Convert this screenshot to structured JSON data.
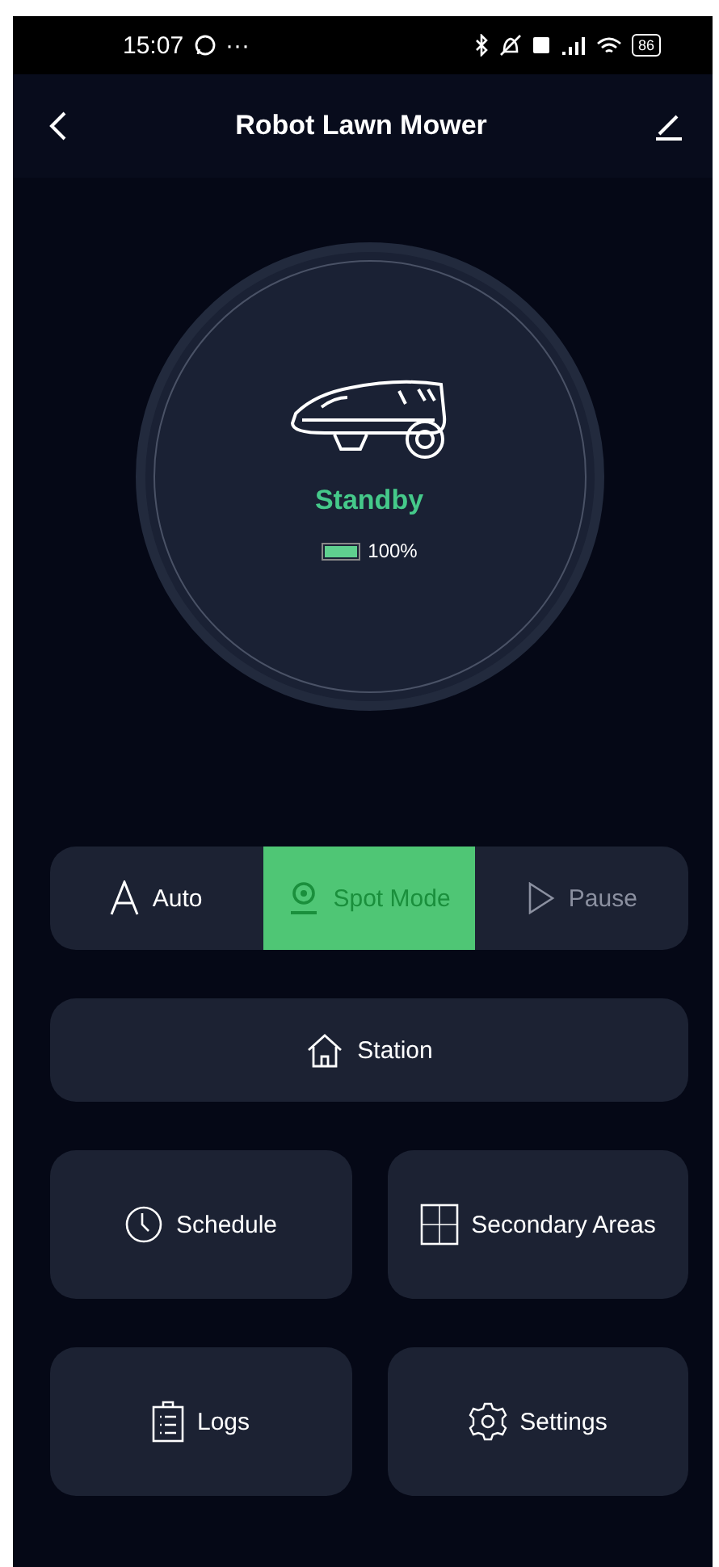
{
  "status_bar": {
    "time": "15:07",
    "dots": "···",
    "battery": "86"
  },
  "header": {
    "title": "Robot Lawn Mower"
  },
  "mower": {
    "status": "Standby",
    "level": 1,
    "battery_text": "100%"
  },
  "modes": [
    {
      "kind": "auto",
      "label": "Auto",
      "selected": false
    },
    {
      "kind": "spot",
      "label": "Spot Mode",
      "selected": true
    },
    {
      "kind": "pause",
      "label": "Pause",
      "selected": false
    }
  ],
  "station": {
    "label": "Station"
  },
  "tiles": [
    {
      "kind": "schedule",
      "label": "Schedule"
    },
    {
      "kind": "areas",
      "label": "Secondary Areas"
    },
    {
      "kind": "logs",
      "label": "Logs"
    },
    {
      "kind": "settings",
      "label": "Settings"
    }
  ]
}
